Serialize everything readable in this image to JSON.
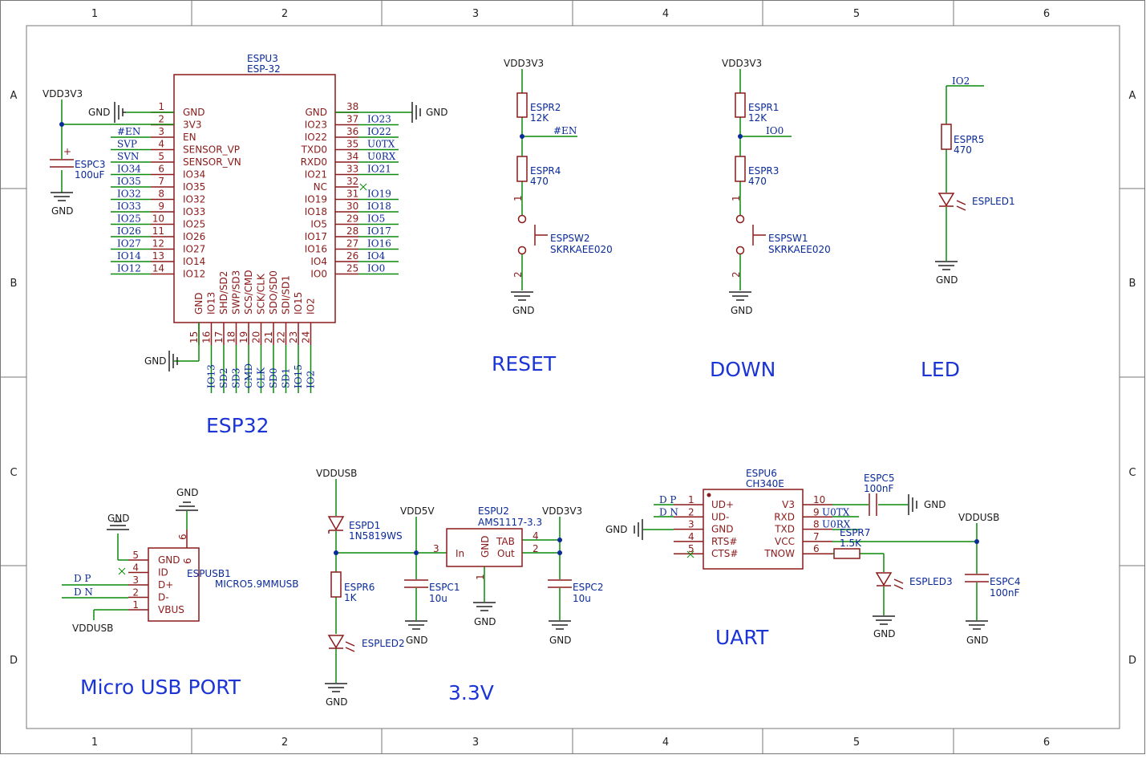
{
  "frame": {
    "cols": [
      "1",
      "2",
      "3",
      "4",
      "5",
      "6"
    ],
    "rows": [
      "A",
      "B",
      "C",
      "D"
    ]
  },
  "section_titles": {
    "esp32": "ESP32",
    "reset": "RESET",
    "down": "DOWN",
    "led": "LED",
    "usb": "Micro USB PORT",
    "v33": "3.3V",
    "uart": "UART"
  },
  "colors": {
    "body": "#8b1a1a",
    "wire": "#0a8a0a",
    "net": "#0a2a9a",
    "title": "#1a34d6"
  },
  "esp32": {
    "ref": "ESPU3",
    "value": "ESP-32",
    "left_pins": [
      {
        "num": "1",
        "name": "GND",
        "net": ""
      },
      {
        "num": "2",
        "name": "3V3",
        "net": ""
      },
      {
        "num": "3",
        "name": "EN",
        "net": "#EN"
      },
      {
        "num": "4",
        "name": "SENSOR_VP",
        "net": "SVP"
      },
      {
        "num": "5",
        "name": "SENSOR_VN",
        "net": "SVN"
      },
      {
        "num": "6",
        "name": "IO34",
        "net": "IO34"
      },
      {
        "num": "7",
        "name": "IO35",
        "net": "IO35"
      },
      {
        "num": "8",
        "name": "IO32",
        "net": "IO32"
      },
      {
        "num": "9",
        "name": "IO33",
        "net": "IO33"
      },
      {
        "num": "10",
        "name": "IO25",
        "net": "IO25"
      },
      {
        "num": "11",
        "name": "IO26",
        "net": "IO26"
      },
      {
        "num": "12",
        "name": "IO27",
        "net": "IO27"
      },
      {
        "num": "13",
        "name": "IO14",
        "net": "IO14"
      },
      {
        "num": "14",
        "name": "IO12",
        "net": "IO12"
      }
    ],
    "right_pins": [
      {
        "num": "38",
        "name": "GND",
        "net": ""
      },
      {
        "num": "37",
        "name": "IO23",
        "net": "IO23"
      },
      {
        "num": "36",
        "name": "IO22",
        "net": "IO22"
      },
      {
        "num": "35",
        "name": "TXD0",
        "net": "U0TX"
      },
      {
        "num": "34",
        "name": "RXD0",
        "net": "U0RX"
      },
      {
        "num": "33",
        "name": "IO21",
        "net": "IO21"
      },
      {
        "num": "32",
        "name": "NC",
        "net": ""
      },
      {
        "num": "31",
        "name": "IO19",
        "net": "IO19"
      },
      {
        "num": "30",
        "name": "IO18",
        "net": "IO18"
      },
      {
        "num": "29",
        "name": "IO5",
        "net": "IO5"
      },
      {
        "num": "28",
        "name": "IO17",
        "net": "IO17"
      },
      {
        "num": "27",
        "name": "IO16",
        "net": "IO16"
      },
      {
        "num": "26",
        "name": "IO4",
        "net": "IO4"
      },
      {
        "num": "25",
        "name": "IO0",
        "net": "IO0"
      }
    ],
    "bottom_pins": [
      {
        "num": "15",
        "name": "GND",
        "net": ""
      },
      {
        "num": "16",
        "name": "IO13",
        "net": "IO13"
      },
      {
        "num": "17",
        "name": "SHD/SD2",
        "net": "SD2"
      },
      {
        "num": "18",
        "name": "SWP/SD3",
        "net": "SD3"
      },
      {
        "num": "19",
        "name": "SCS/CMD",
        "net": "CMD"
      },
      {
        "num": "20",
        "name": "SCK/CLK",
        "net": "CLK"
      },
      {
        "num": "21",
        "name": "SDO/SD0",
        "net": "SD0"
      },
      {
        "num": "22",
        "name": "SDI/SD1",
        "net": "SD1"
      },
      {
        "num": "23",
        "name": "IO15",
        "net": "IO15"
      },
      {
        "num": "24",
        "name": "IO2",
        "net": "IO2"
      }
    ],
    "cap": {
      "ref": "ESPC3",
      "value": "100uF",
      "plus": "+"
    },
    "vdd_label": "VDD3V3",
    "gnd_label": "GND"
  },
  "reset": {
    "vdd": "VDD3V3",
    "r1": {
      "ref": "ESPR2",
      "value": "12K"
    },
    "r2": {
      "ref": "ESPR4",
      "value": "470"
    },
    "net": "#EN",
    "sw": {
      "ref": "ESPSW2",
      "value": "SKRKAEE020"
    },
    "pin1": "1",
    "pin2": "2",
    "gnd": "GND"
  },
  "down": {
    "vdd": "VDD3V3",
    "r1": {
      "ref": "ESPR1",
      "value": "12K"
    },
    "r2": {
      "ref": "ESPR3",
      "value": "470"
    },
    "net": "IO0",
    "sw": {
      "ref": "ESPSW1",
      "value": "SKRKAEE020"
    },
    "pin1": "1",
    "pin2": "2",
    "gnd": "GND"
  },
  "led": {
    "net": "IO2",
    "r": {
      "ref": "ESPR5",
      "value": "470"
    },
    "d": {
      "ref": "ESPLED1"
    },
    "gnd": "GND"
  },
  "usb": {
    "ref": "ESPUSB1",
    "value": "MICRO5.9MMUSB",
    "pins": [
      {
        "num": "5",
        "name": "GND"
      },
      {
        "num": "4",
        "name": "ID"
      },
      {
        "num": "3",
        "name": "D+"
      },
      {
        "num": "2",
        "name": "D-"
      },
      {
        "num": "1",
        "name": "VBUS"
      }
    ],
    "pin6": "6",
    "pin6_name": "6",
    "gnd_top": "GND",
    "gnd_left": "GND",
    "dp": "D P",
    "dn": "D N",
    "vdd": "VDDUSB"
  },
  "v33": {
    "vddusb": "VDDUSB",
    "diode": {
      "ref": "ESPD1",
      "value": "1N5819WS"
    },
    "vdd5": "VDD5V",
    "reg": {
      "ref": "ESPU2",
      "value": "AMS1117-3.3",
      "in": "In",
      "out": "Out",
      "tab": "TAB",
      "gnd": "GND",
      "p1": "1",
      "p2": "2",
      "p3": "3",
      "p4": "4"
    },
    "vdd33": "VDD3V3",
    "r6": {
      "ref": "ESPR6",
      "value": "1K"
    },
    "led2": {
      "ref": "ESPLED2"
    },
    "c1": {
      "ref": "ESPC1",
      "value": "10u"
    },
    "c2": {
      "ref": "ESPC2",
      "value": "10u"
    },
    "gnd": "GND"
  },
  "uart": {
    "ref": "ESPU6",
    "value": "CH340E",
    "left_pins": [
      {
        "num": "1",
        "name": "UD+",
        "net": "D P"
      },
      {
        "num": "2",
        "name": "UD-",
        "net": "D N"
      },
      {
        "num": "3",
        "name": "GND",
        "net": ""
      },
      {
        "num": "4",
        "name": "RTS#",
        "net": ""
      },
      {
        "num": "5",
        "name": "CTS#",
        "net": ""
      }
    ],
    "right_pins": [
      {
        "num": "10",
        "name": "V3",
        "net": ""
      },
      {
        "num": "9",
        "name": "RXD",
        "net": "U0TX"
      },
      {
        "num": "8",
        "name": "TXD",
        "net": "U0RX"
      },
      {
        "num": "7",
        "name": "VCC",
        "net": ""
      },
      {
        "num": "6",
        "name": "TNOW",
        "net": ""
      }
    ],
    "c5": {
      "ref": "ESPC5",
      "value": "100nF"
    },
    "r7": {
      "ref": "ESPR7",
      "value": "1.5K"
    },
    "led3": {
      "ref": "ESPLED3"
    },
    "c4": {
      "ref": "ESPC4",
      "value": "100nF"
    },
    "vddusb": "VDDUSB",
    "gnd": "GND"
  }
}
